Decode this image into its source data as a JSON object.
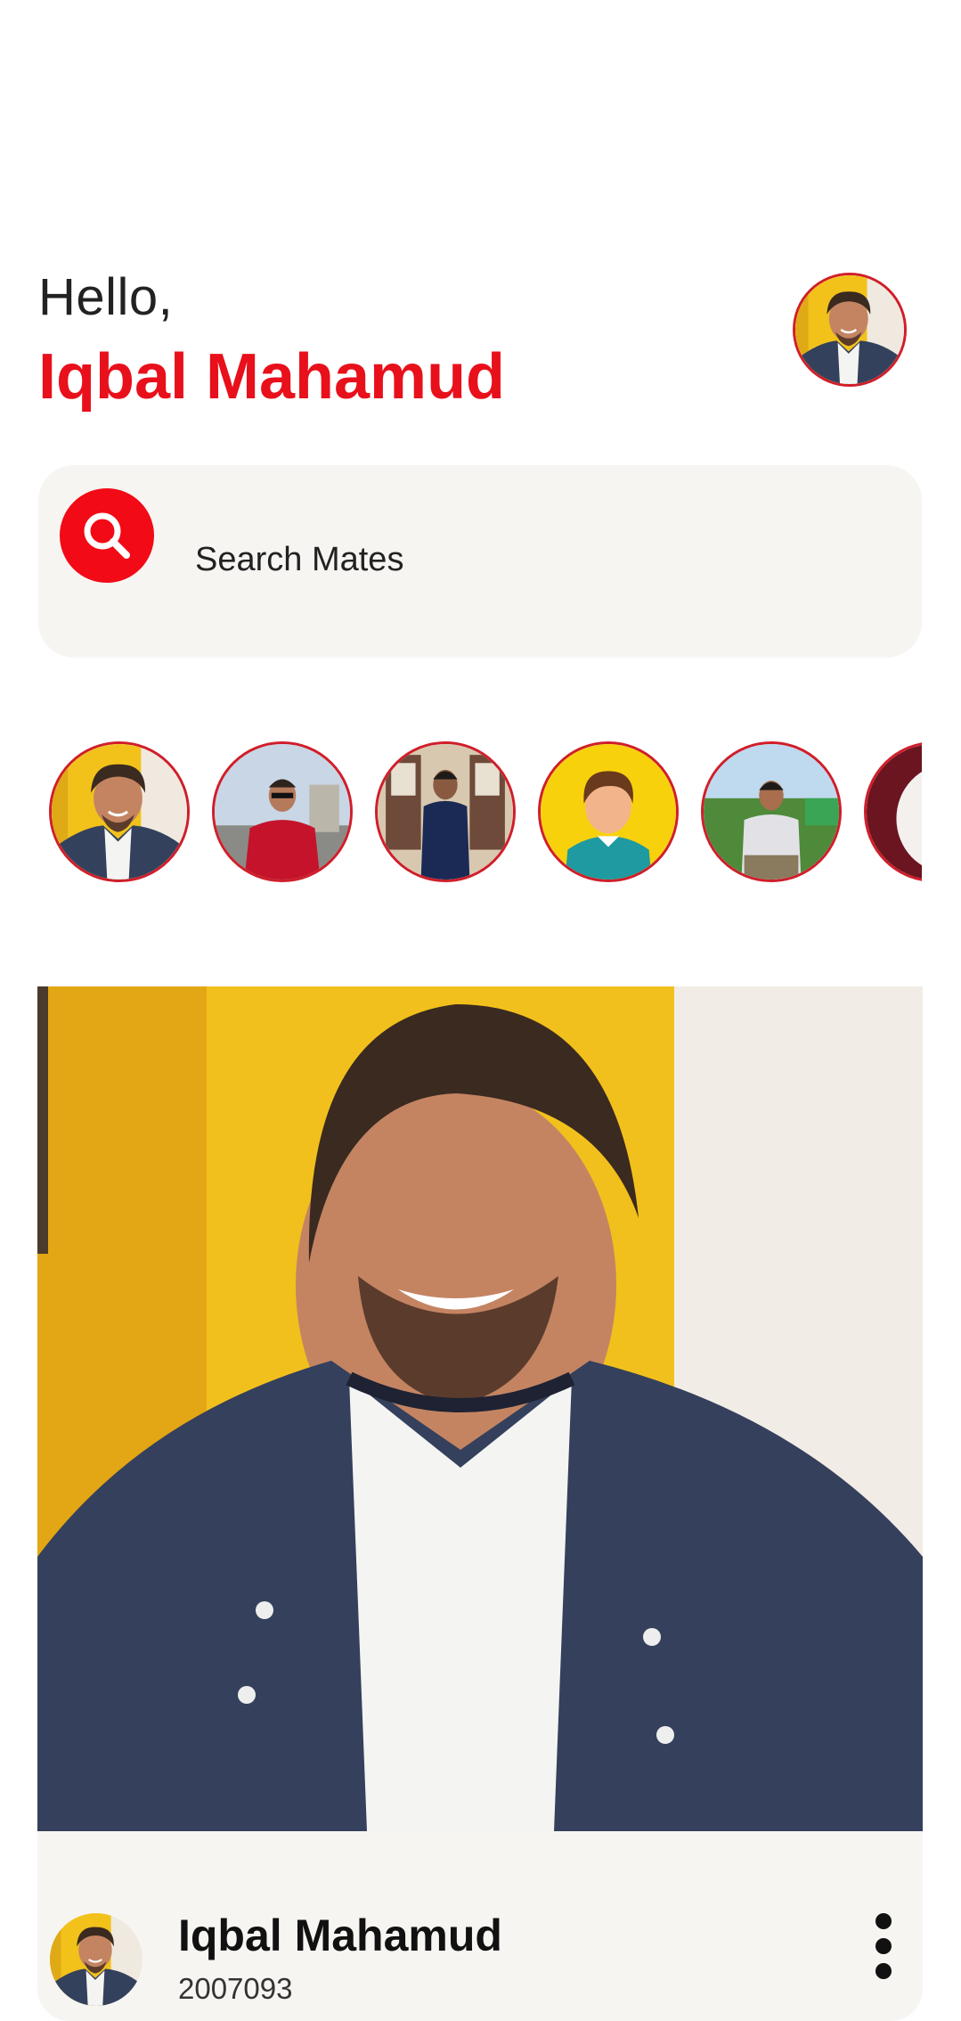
{
  "header": {
    "greeting": "Hello,",
    "user_name": "Iqbal Mahamud"
  },
  "search": {
    "placeholder": "Search Mates",
    "icon": "search-icon"
  },
  "stories": [
    {
      "name": "story-1",
      "kind": "photo"
    },
    {
      "name": "story-2",
      "kind": "photo"
    },
    {
      "name": "story-3",
      "kind": "photo"
    },
    {
      "name": "story-4",
      "kind": "default-avatar"
    },
    {
      "name": "story-5",
      "kind": "photo"
    },
    {
      "name": "story-6",
      "kind": "photo"
    }
  ],
  "post": {
    "author": "Iqbal Mahamud",
    "author_id": "2007093",
    "more_icon": "more-vertical-icon"
  },
  "colors": {
    "accent": "#e8101b",
    "surface": "#f7f5f2",
    "ring": "#d01e2a"
  }
}
